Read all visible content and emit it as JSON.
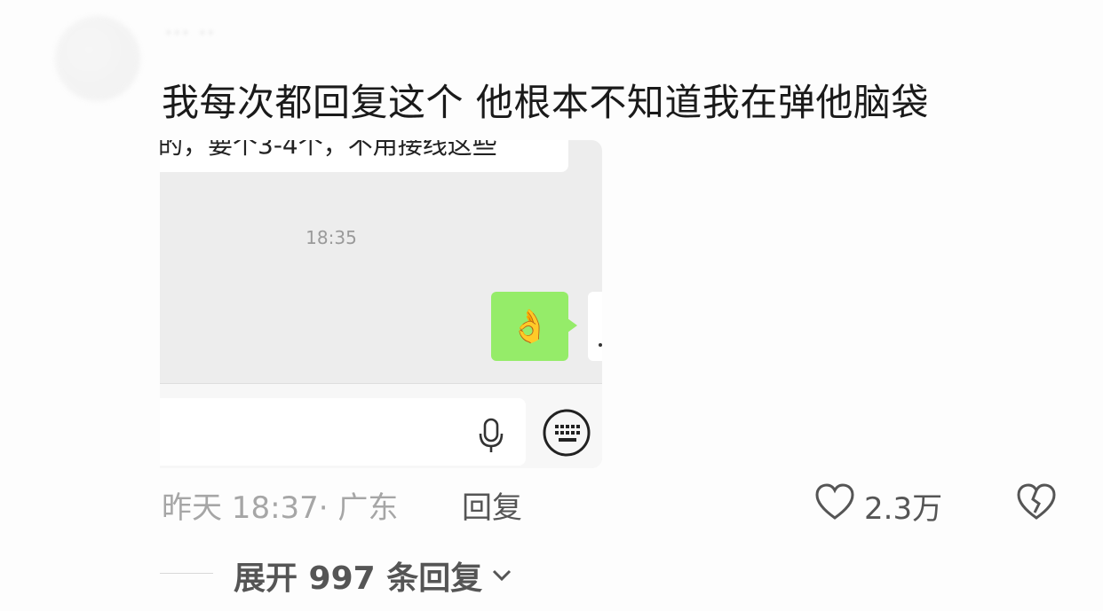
{
  "comment": {
    "text": "我每次都回复这个 他根本不知道我在弹他脑袋",
    "time_location": "昨天 18:37· 广东",
    "reply_label": "回复",
    "like_count": "2.3万",
    "expand_replies": "展开 997 条回复"
  },
  "chat_screenshot": {
    "previous_bubble_fragment": "的，要个3-4个，不用接线这些",
    "timestamp": "18:35",
    "sent_message": "👌",
    "icons": [
      "mic-icon",
      "keyboard-icon"
    ],
    "bubble_color": "#95ec69"
  }
}
